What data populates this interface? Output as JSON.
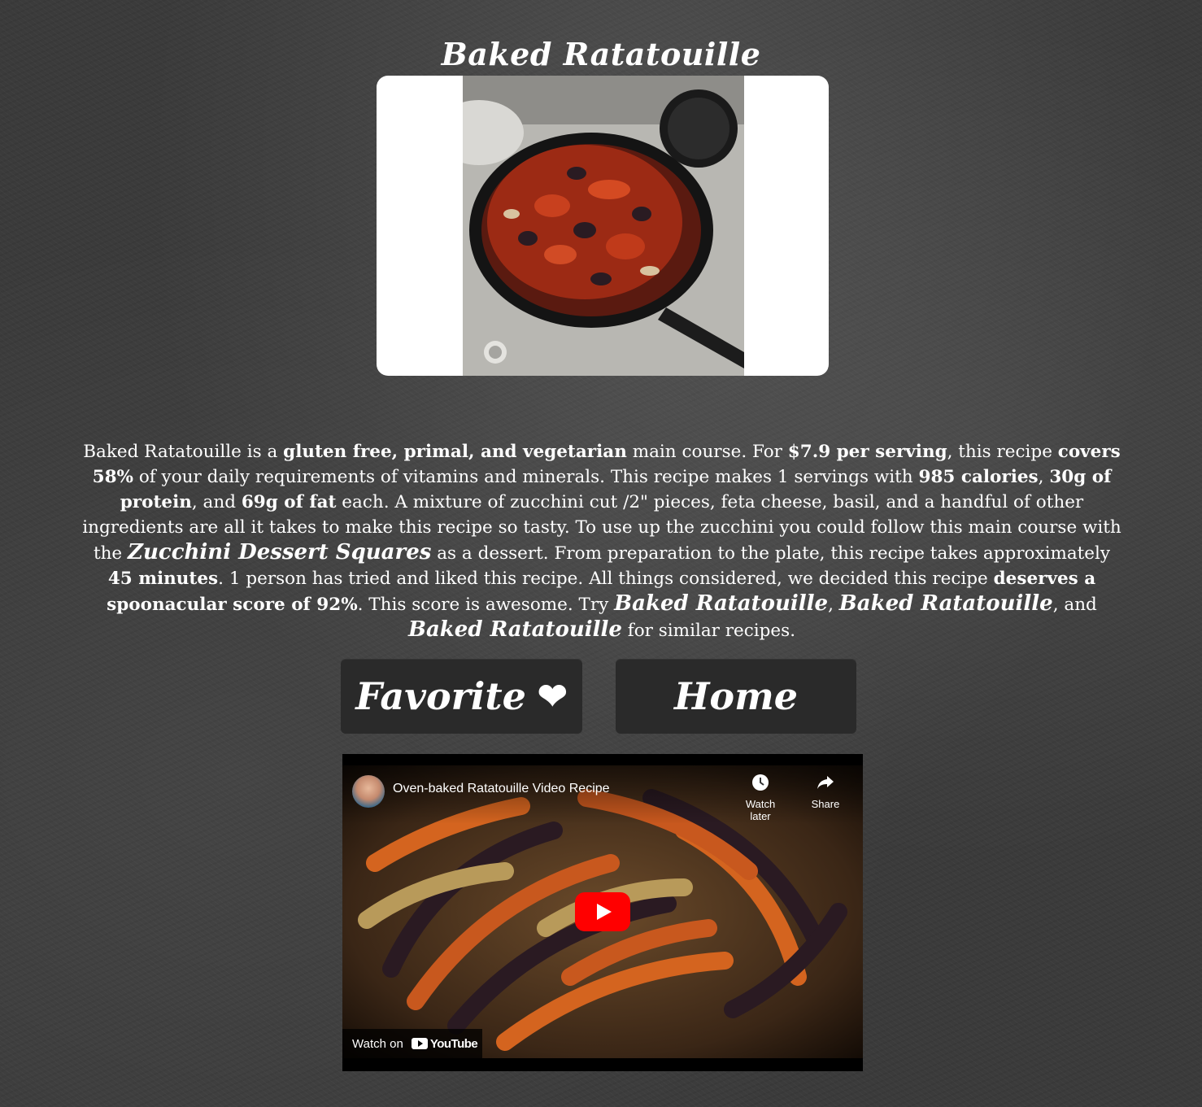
{
  "recipe": {
    "title": "Baked Ratatouille"
  },
  "summary": {
    "p1": "Baked Ratatouille is a ",
    "diets": "gluten free, primal, and vegetarian",
    "p2": " main course. For ",
    "price": "$7.9 per serving",
    "p3": ", this recipe ",
    "covers": "covers 58%",
    "p4": " of your daily requirements of vitamins and minerals. This recipe makes 1 servings with ",
    "calories": "985 calories",
    "p5": ", ",
    "protein": "30g of protein",
    "p6": ", and ",
    "fat": "69g of fat",
    "p7": " each. A mixture of zucchini cut /2\" pieces, feta cheese, basil, and a handful of other ingredients are all it takes to make this recipe so tasty. To use up the zucchini you could follow this main course with the ",
    "dessert_link": "Zucchini Dessert Squares",
    "p8": " as a dessert. From preparation to the plate, this recipe takes approximately ",
    "time": "45 minutes",
    "p9": ". 1 person has tried and liked this recipe. All things considered, we decided this recipe ",
    "score": "deserves a spoonacular score of 92%",
    "p10": ". This score is awesome. Try ",
    "similar1": "Baked Ratatouille",
    "p11": ", ",
    "similar2": "Baked Ratatouille",
    "p12": ", and ",
    "similar3": "Baked Ratatouille",
    "p13": " for similar recipes."
  },
  "buttons": {
    "favorite_label": "Favorite",
    "favorite_icon": "❤",
    "home_label": "Home"
  },
  "video": {
    "title": "Oven-baked Ratatouille Video Recipe",
    "watch_later": "Watch later",
    "share": "Share",
    "watch_on": "Watch on",
    "youtube": "YouTube"
  },
  "colors": {
    "background": "#3b3b3b",
    "button": "#2a2a2a",
    "play_button": "#ff0000"
  }
}
